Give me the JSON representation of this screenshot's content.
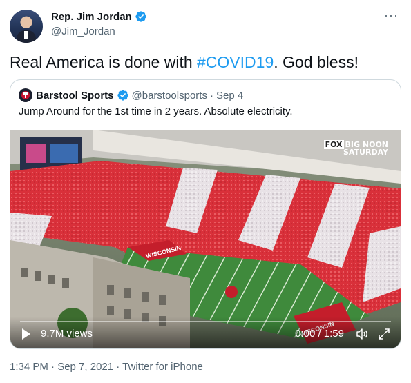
{
  "author": {
    "display_name": "Rep. Jim Jordan",
    "handle": "@Jim_Jordan"
  },
  "tweet": {
    "text_before": "Real America is done with ",
    "hashtag": "#COVID19",
    "text_after": ". God bless!"
  },
  "quoted": {
    "display_name": "Barstool Sports",
    "handle": "@barstoolsports",
    "separator": "·",
    "date": "Sep 4",
    "text": "Jump Around for the 1st time in 2 years. Absolute electricity."
  },
  "video": {
    "overlay_brand_line1": "BIG NOON",
    "overlay_brand_fox": "FOX",
    "overlay_brand_line2": "SATURDAY",
    "endzone_text": "WISCONSIN",
    "views": "9.7M views",
    "time": "0:00 / 1:59",
    "progress": 0
  },
  "footer": {
    "meta": "1:34 PM · Sep 7, 2021 · Twitter for iPhone"
  },
  "colors": {
    "accent": "#1d9bf0",
    "secondary_text": "#536471",
    "border": "#cfd9de",
    "stadium_red": "#d9303a",
    "field_green": "#3f8a3c"
  },
  "icons": {
    "verified": "verified-badge-icon",
    "more": "more-dots-icon",
    "play": "play-icon",
    "volume": "volume-icon",
    "fullscreen": "fullscreen-icon"
  }
}
